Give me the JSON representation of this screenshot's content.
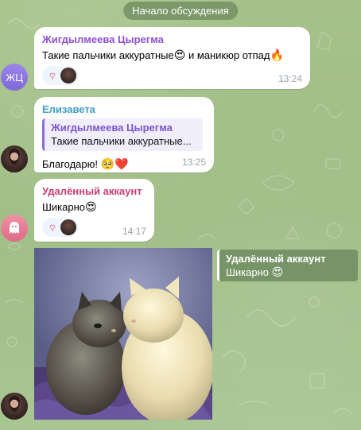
{
  "chat": {
    "date_pill": "Начало обсуждения",
    "messages": [
      {
        "avatar_initials": "ЖЦ",
        "avatar_color": "#8c78e0",
        "sender": "Жигдылмеева Цырегма",
        "sender_color": "#8f4fd1",
        "text": "Такие пальчики аккуратные",
        "emoji_1": "😍",
        "text_2": " и маникюр отпад",
        "emoji_2": "🔥",
        "reaction_icon": "heart-outline-icon",
        "time": "13:24"
      },
      {
        "sender": "Елизавета",
        "sender_color": "#3f9dc4",
        "reply_to_name": "Жигдылмеева Цырегма",
        "reply_to_text": "Такие пальчики аккуратные...",
        "text": "Благодарю! ",
        "emoji_1": "🥺",
        "emoji_2": "❤️",
        "time": "13:25"
      },
      {
        "avatar_icon": "ghost-icon",
        "sender": "Удалённый аккаунт",
        "sender_color": "#cc3d74",
        "text": "Шикарно",
        "emoji_1": "😍",
        "reaction_icon": "heart-outline-icon",
        "time": "14:17"
      },
      {
        "type": "photo",
        "photo_subject": "two kittens",
        "side_reply_name": "Удалённый аккаунт",
        "side_reply_text": "Шикарно",
        "side_reply_emoji": "😍"
      }
    ]
  }
}
